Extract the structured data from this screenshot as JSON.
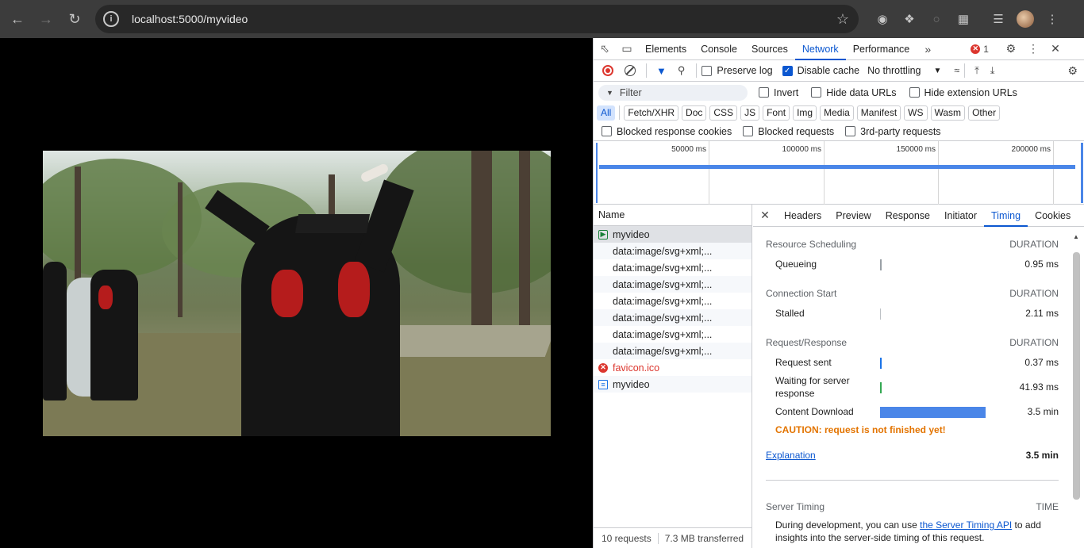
{
  "browser": {
    "url": "localhost:5000/myvideo"
  },
  "devtools": {
    "tabs": [
      "Elements",
      "Console",
      "Sources",
      "Network",
      "Performance"
    ],
    "active_tab": "Network",
    "error_count": "1",
    "toolbar": {
      "preserve_log": "Preserve log",
      "disable_cache": "Disable cache",
      "throttling": "No throttling"
    },
    "filter": {
      "placeholder": "Filter",
      "invert": "Invert",
      "hide_data_urls": "Hide data URLs",
      "hide_extension_urls": "Hide extension URLs"
    },
    "types": [
      "All",
      "Fetch/XHR",
      "Doc",
      "CSS",
      "JS",
      "Font",
      "Img",
      "Media",
      "Manifest",
      "WS",
      "Wasm",
      "Other"
    ],
    "blocked": {
      "cookies": "Blocked response cookies",
      "requests": "Blocked requests",
      "third_party": "3rd-party requests"
    },
    "overview_ticks": [
      "50000 ms",
      "100000 ms",
      "150000 ms",
      "200000 ms"
    ],
    "list": {
      "header": "Name",
      "requests": [
        {
          "name": "myvideo",
          "icon": "media-icon"
        },
        {
          "name": "data:image/svg+xml;..."
        },
        {
          "name": "data:image/svg+xml;..."
        },
        {
          "name": "data:image/svg+xml;..."
        },
        {
          "name": "data:image/svg+xml;..."
        },
        {
          "name": "data:image/svg+xml;..."
        },
        {
          "name": "data:image/svg+xml;..."
        },
        {
          "name": "data:image/svg+xml;..."
        },
        {
          "name": "favicon.ico",
          "icon": "error-icon"
        },
        {
          "name": "myvideo",
          "icon": "document-icon"
        }
      ],
      "footer_requests": "10 requests",
      "footer_transferred": "7.3 MB transferred"
    },
    "detail": {
      "tabs": [
        "Headers",
        "Preview",
        "Response",
        "Initiator",
        "Timing",
        "Cookies"
      ],
      "active_tab": "Timing",
      "sections": {
        "scheduling": "Resource Scheduling",
        "connection": "Connection Start",
        "request": "Request/Response",
        "duration": "DURATION"
      },
      "rows": {
        "queueing": {
          "label": "Queueing",
          "value": "0.95 ms"
        },
        "stalled": {
          "label": "Stalled",
          "value": "2.11 ms"
        },
        "request_sent": {
          "label": "Request sent",
          "value": "0.37 ms"
        },
        "waiting": {
          "label": "Waiting for server response",
          "value": "41.93 ms"
        },
        "download": {
          "label": "Content Download",
          "value": "3.5 min"
        }
      },
      "caution": "CAUTION: request is not finished yet!",
      "explanation": "Explanation",
      "total": "3.5 min",
      "server_timing": {
        "title": "Server Timing",
        "time": "TIME",
        "text_before": "During development, you can use ",
        "link": "the Server Timing API",
        "text_after": " to add insights into the server-side timing of this request."
      }
    }
  },
  "colors": {
    "accent": "#0b57d0",
    "error": "#dc362e",
    "caution": "#e37400",
    "download_bar": "#4a86e8"
  }
}
